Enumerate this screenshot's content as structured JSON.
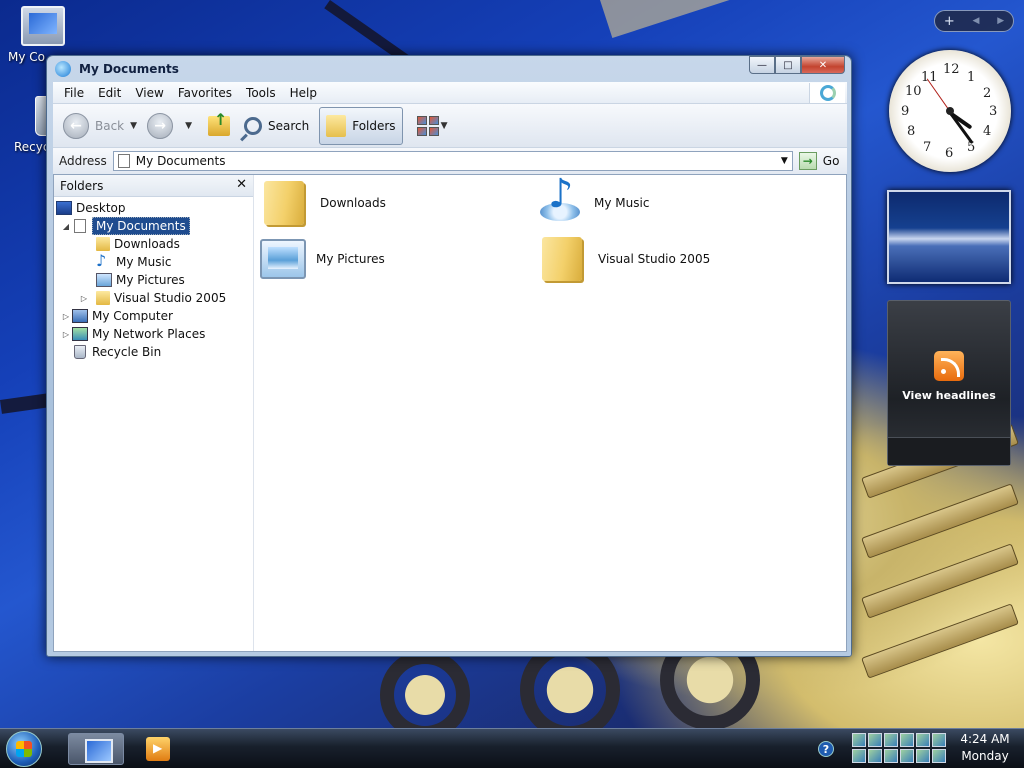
{
  "desktop": {
    "icons": [
      {
        "label": "My Co"
      },
      {
        "label": "Recyc"
      }
    ]
  },
  "sidebar": {
    "add_label": "+",
    "prev_label": "◀",
    "next_label": "▶",
    "clock_numbers": [
      "12",
      "1",
      "2",
      "3",
      "4",
      "5",
      "6",
      "7",
      "8",
      "9",
      "10",
      "11"
    ],
    "feed": {
      "label": "View headlines"
    }
  },
  "window": {
    "title": "My Documents",
    "buttons": {
      "minimize": "—",
      "maximize": "□",
      "close": "✕"
    },
    "menu": [
      "File",
      "Edit",
      "View",
      "Favorites",
      "Tools",
      "Help"
    ],
    "toolbar": {
      "back_label": "Back",
      "search_label": "Search",
      "folders_label": "Folders"
    },
    "address": {
      "label": "Address",
      "value": "My Documents",
      "go_label": "Go"
    },
    "folders_pane": {
      "title": "Folders",
      "close": "✕",
      "tree": [
        {
          "label": "Desktop",
          "icon": "desktop-icon",
          "expander": ""
        },
        {
          "label": "My Documents",
          "icon": "document-icon",
          "expander": "◢"
        },
        {
          "label": "Downloads",
          "icon": "folder-icon",
          "expander": ""
        },
        {
          "label": "My Music",
          "icon": "music-icon",
          "expander": ""
        },
        {
          "label": "My Pictures",
          "icon": "pictures-icon",
          "expander": ""
        },
        {
          "label": "Visual Studio 2005",
          "icon": "folder-icon",
          "expander": "▷"
        },
        {
          "label": "My Computer",
          "icon": "computer-icon",
          "expander": "▷"
        },
        {
          "label": "My Network Places",
          "icon": "network-icon",
          "expander": "▷"
        },
        {
          "label": "Recycle Bin",
          "icon": "recycle-bin-icon",
          "expander": ""
        }
      ]
    },
    "files": [
      {
        "label": "Downloads",
        "icon": "folder-icon"
      },
      {
        "label": "My Music",
        "icon": "music-folder-icon"
      },
      {
        "label": "My Pictures",
        "icon": "pictures-folder-icon"
      },
      {
        "label": "Visual Studio 2005",
        "icon": "folder-icon"
      }
    ]
  },
  "taskbar": {
    "help": "?",
    "time": "4:24 AM",
    "day": "Monday"
  }
}
